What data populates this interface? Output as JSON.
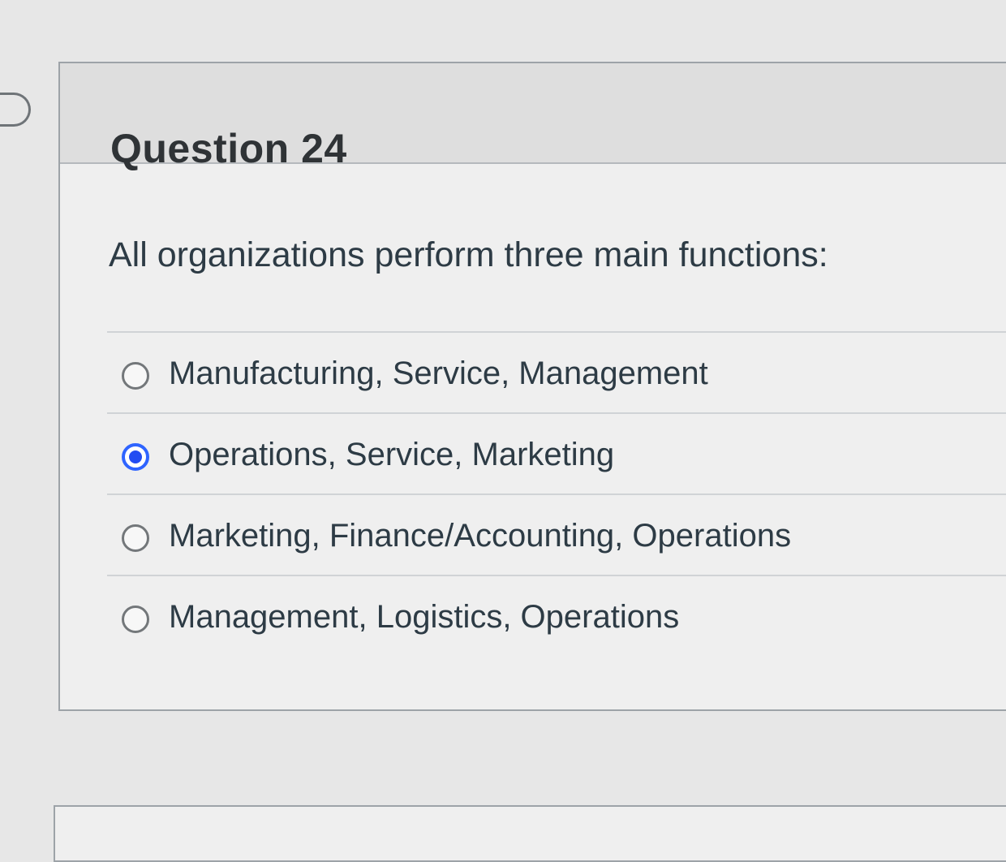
{
  "question": {
    "title": "Question 24",
    "text": "All organizations perform three main functions:",
    "answers": [
      {
        "label": "Manufacturing, Service, Management",
        "selected": false
      },
      {
        "label": "Operations, Service, Marketing",
        "selected": true
      },
      {
        "label": "Marketing, Finance/Accounting, Operations",
        "selected": false
      },
      {
        "label": "Management, Logistics, Operations",
        "selected": false
      }
    ]
  },
  "icons": {
    "flag": "bookmark-flag-icon",
    "radio": "radio-button-icon"
  },
  "colors": {
    "selected_radio": "#234cf2",
    "header_background": "#dedede",
    "page_background": "#e7e7e7",
    "text": "#2d3b45"
  }
}
